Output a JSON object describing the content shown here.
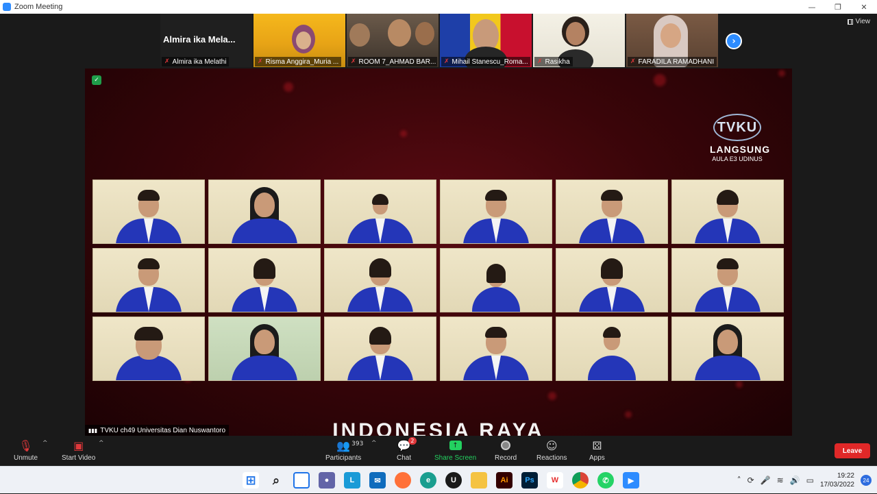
{
  "window": {
    "title": "Zoom Meeting",
    "minimize": "—",
    "maximize": "❐",
    "close": "✕"
  },
  "strip": {
    "active_name": "Almira ika Mela...",
    "participants": [
      {
        "name": "Almira ika Melathi"
      },
      {
        "name": "Risma Anggira_Muria ..."
      },
      {
        "name": "ROOM 7_AHMAD BAR..."
      },
      {
        "name": "Mihail Stanescu_Roma..."
      },
      {
        "name": "Rasikha"
      },
      {
        "name": "FARADILA RAMADHANI"
      }
    ],
    "next_label": "›",
    "view_label": "View"
  },
  "share": {
    "logo_text": "TVKU",
    "live_label": "LANGSUNG",
    "venue_label": "AULA E3 UDINUS",
    "song_title": "INDONESIA RAYA",
    "source_label": "TVKU ch49 Universitas Dian Nuswantoro",
    "source_icon": "signal-bars-icon",
    "security_icon": "shield-icon"
  },
  "toolbar": {
    "unmute": "Unmute",
    "start_video": "Start Video",
    "participants": "Participants",
    "participants_count": "393",
    "chat": "Chat",
    "chat_badge": "2",
    "share_screen": "Share Screen",
    "record": "Record",
    "reactions": "Reactions",
    "apps": "Apps",
    "leave": "Leave"
  },
  "taskbar": {
    "apps": [
      "windows-start-icon",
      "search-icon",
      "task-view-icon",
      "teams-chat-icon",
      "lens-icon",
      "mail-icon",
      "firefox-icon",
      "edge-icon",
      "upwork-icon",
      "file-explorer-icon",
      "illustrator-icon",
      "photoshop-icon",
      "wps-icon",
      "chrome-icon",
      "whatsapp-icon",
      "zoom-icon"
    ],
    "time": "19:22",
    "date": "17/03/2022",
    "notifications": "24"
  }
}
